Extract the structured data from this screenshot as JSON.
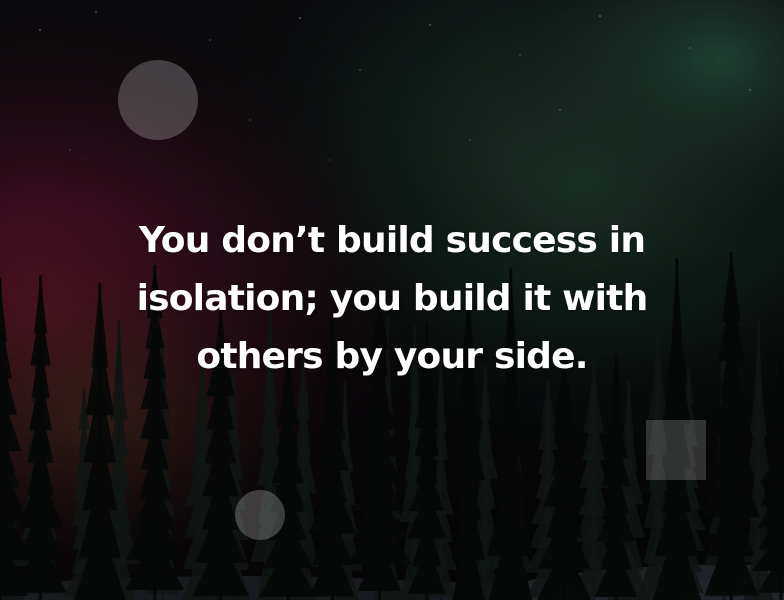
{
  "quote": {
    "text": "You don’t build success in isolation; you build it with others by your side."
  },
  "background": {
    "subject": "aurora borealis over pine forest at night",
    "colors": {
      "aurora_red": "#7a1530",
      "aurora_green": "#1f4a34",
      "sky": "#0b0b0d",
      "snow": "#cfd2d8"
    }
  },
  "decorations": {
    "shapes": [
      "circle",
      "circle",
      "square"
    ],
    "fill": "rgba(255,255,255,0.22)"
  }
}
